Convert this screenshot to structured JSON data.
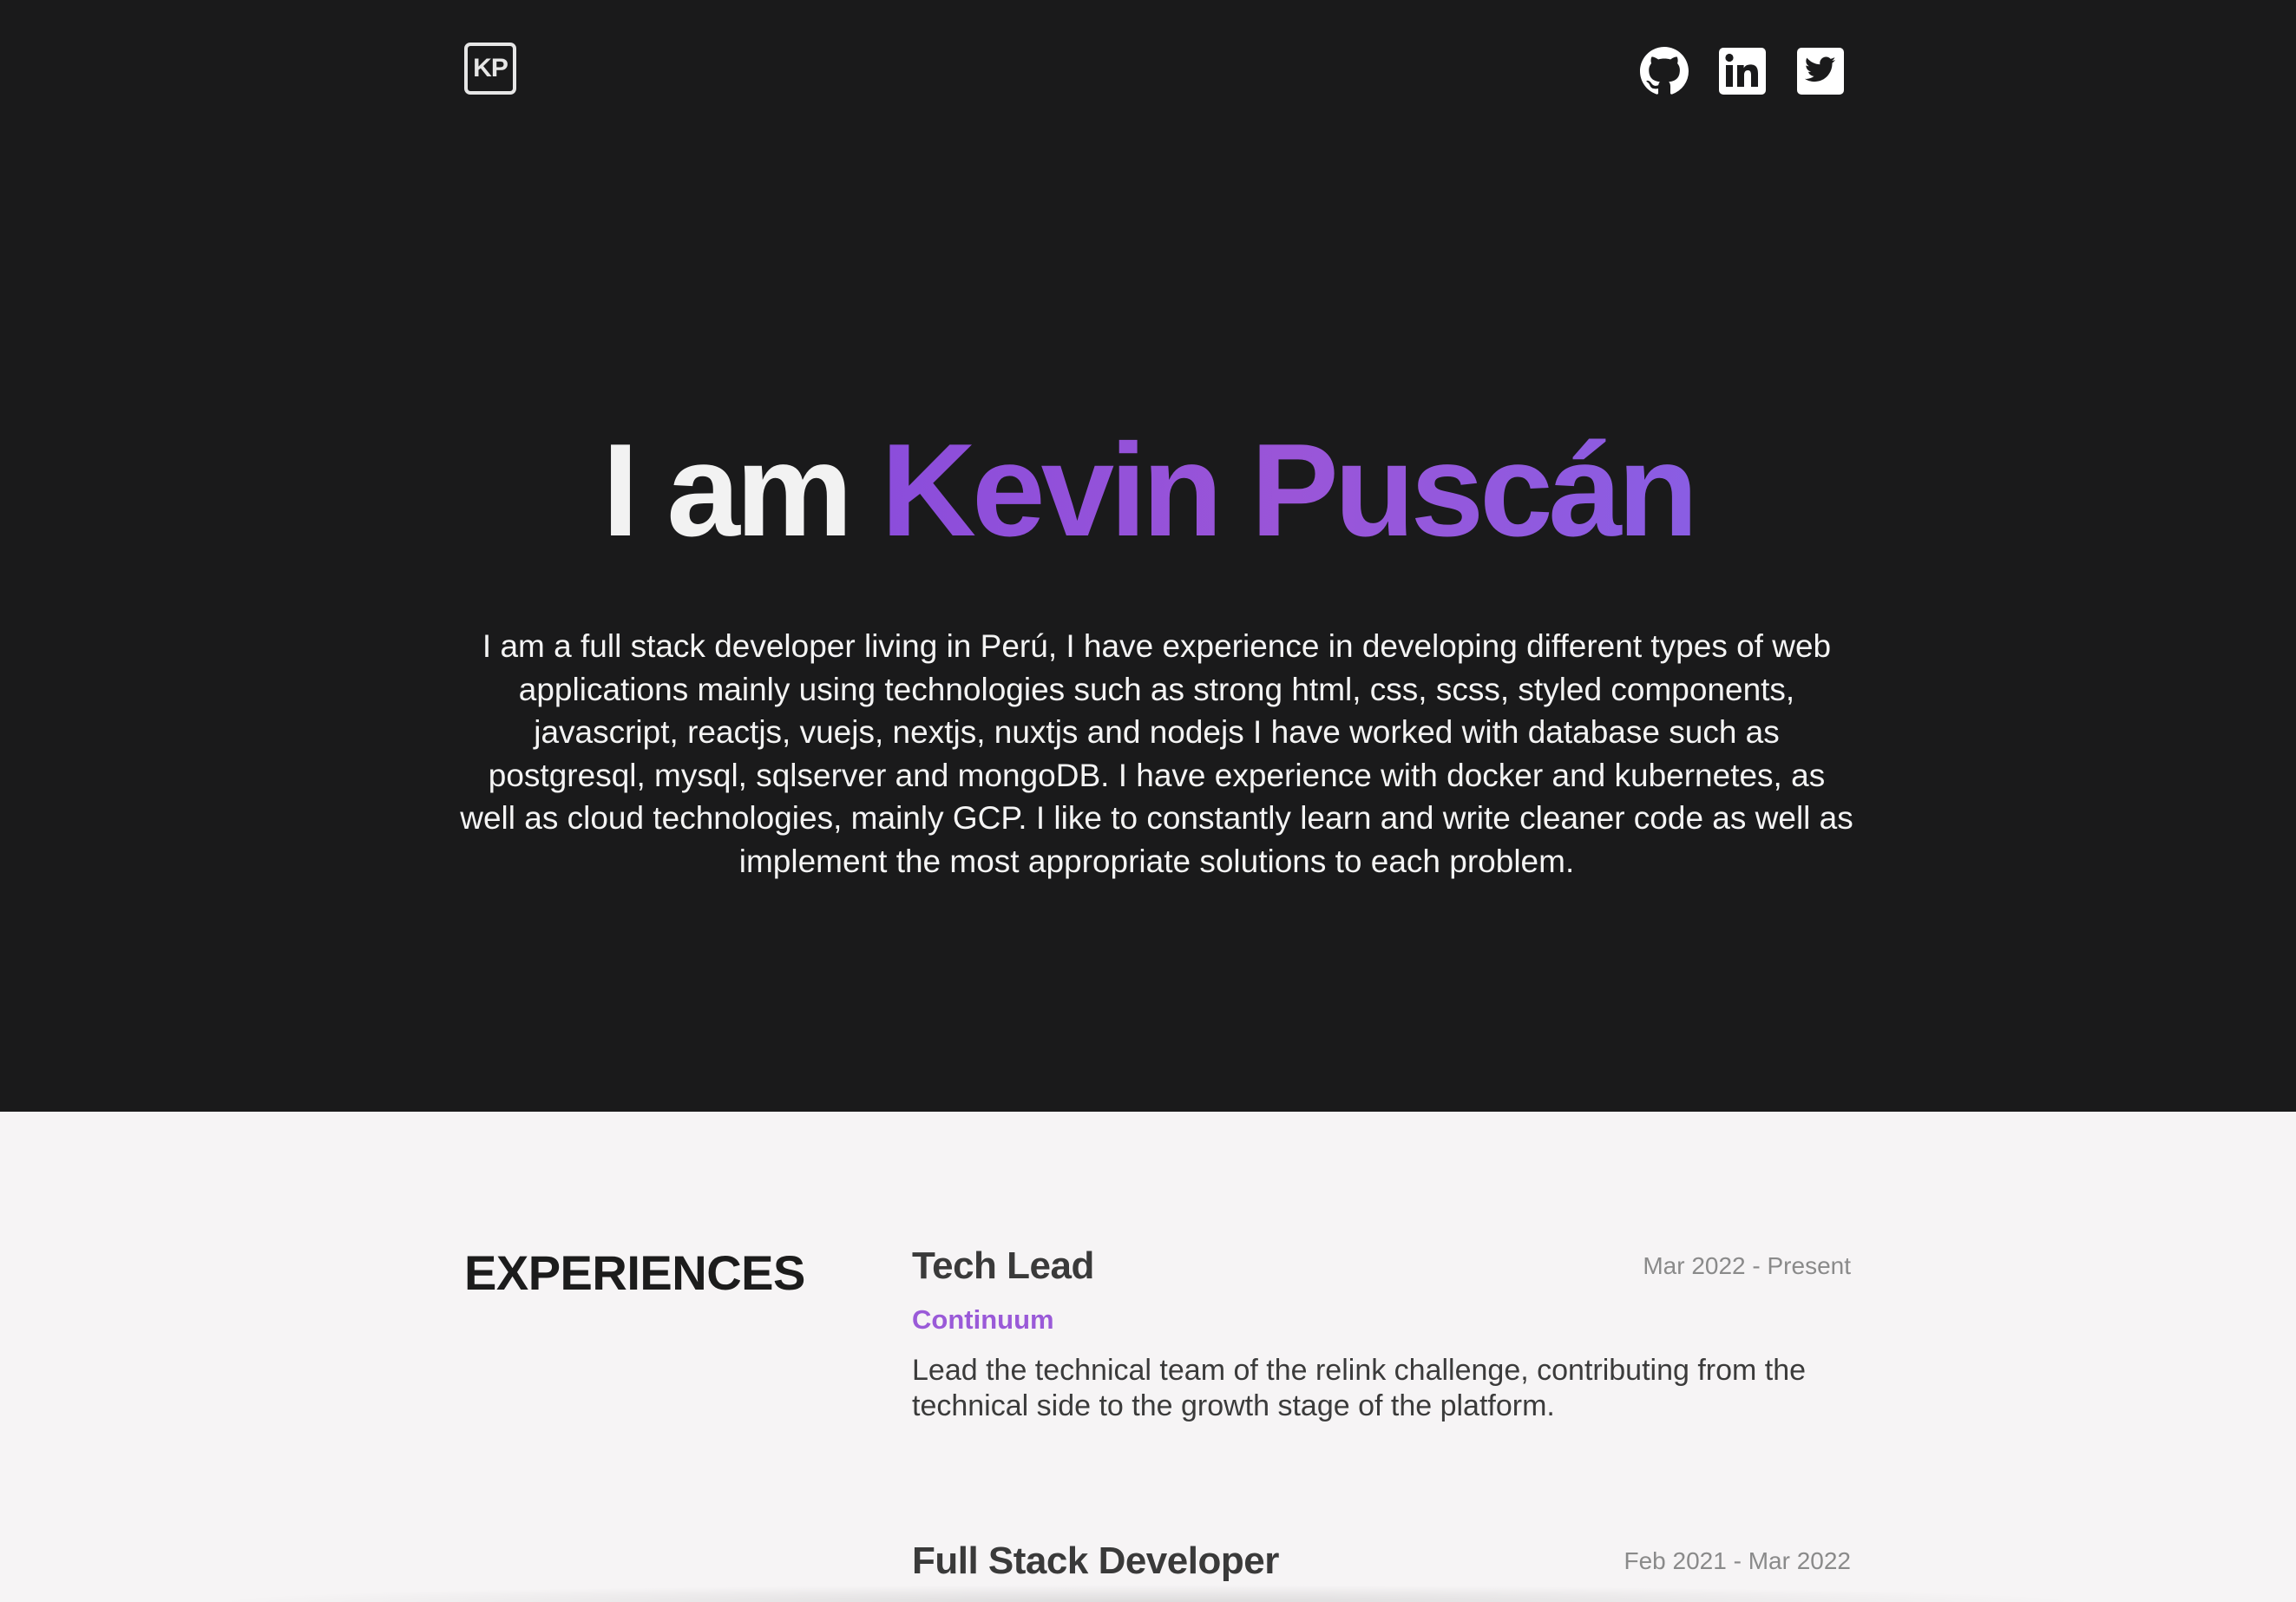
{
  "header": {
    "logo_text": "KP",
    "socials": [
      {
        "name": "github",
        "icon": "github-icon"
      },
      {
        "name": "linkedin",
        "icon": "linkedin-icon"
      },
      {
        "name": "twitter",
        "icon": "twitter-icon"
      }
    ]
  },
  "hero": {
    "title_lead": "I am ",
    "title_name": "Kevin Puscán",
    "bio": "I am a full stack developer living in Perú, I have experience in developing different types of web applications mainly using technologies such as strong html, css, scss, styled components, javascript, reactjs, vuejs, nextjs, nuxtjs and nodejs I have worked with database such as postgresql, mysql, sqlserver and mongoDB. I have experience with docker and kubernetes, as well as cloud technologies, mainly GCP. I like to constantly learn and write cleaner code as well as implement the most appropriate solutions to each problem."
  },
  "experiences": {
    "section_title": "EXPERIENCES",
    "items": [
      {
        "title": "Tech Lead",
        "date": "Mar 2022 - Present",
        "company": "Continuum",
        "description": "Lead the technical team of the relink challenge, contributing from the technical side to the growth stage of the platform."
      },
      {
        "title": "Full Stack Developer",
        "date": "Feb 2021 - Mar 2022"
      }
    ]
  },
  "colors": {
    "hero_bg": "#1a1a1b",
    "page_bg": "#f6f4f5",
    "accent": "#9a55d8"
  }
}
